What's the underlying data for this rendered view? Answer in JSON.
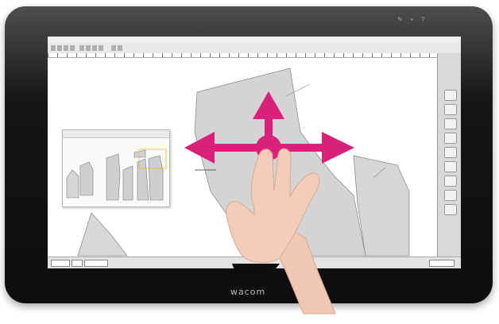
{
  "device": {
    "brand_label": "wacom"
  },
  "colors": {
    "bezel": "#111112",
    "arrow_accent": "#d9207a",
    "pattern_fill": "#d4d4d4",
    "skin": "#f2cdb9"
  },
  "icons": [
    "pan-arrows-icon",
    "hand-gesture",
    "logo-icon"
  ]
}
